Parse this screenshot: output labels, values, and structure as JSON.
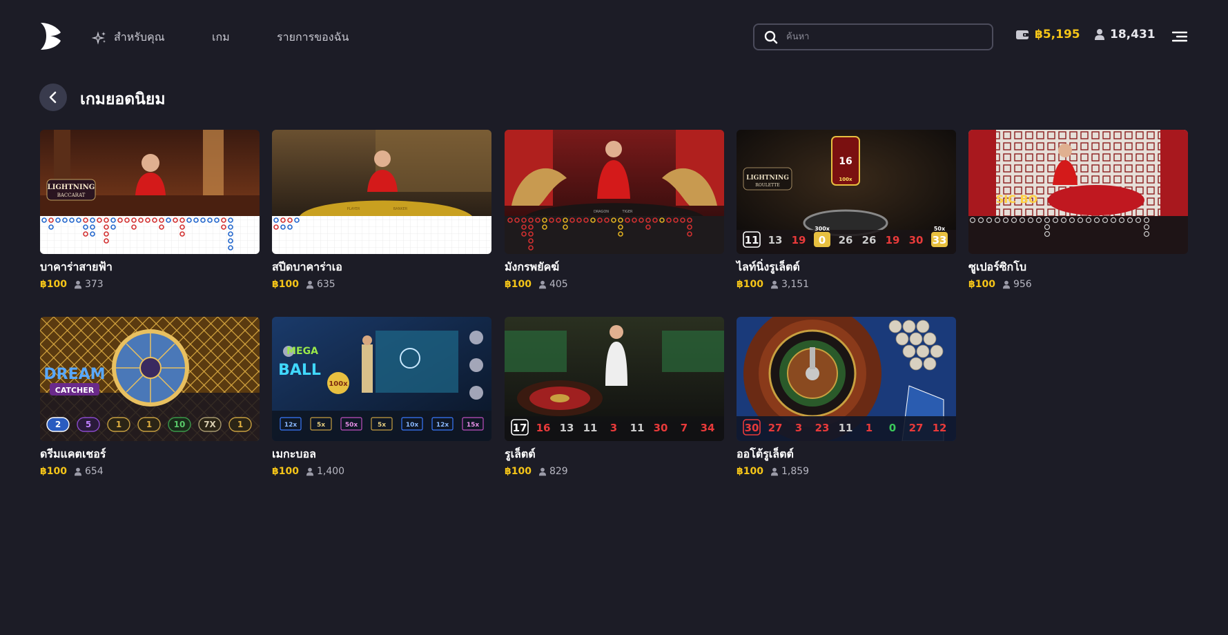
{
  "nav": {
    "for_you": "สำหรับคุณ",
    "games": "เกม",
    "my_list": "รายการของฉัน"
  },
  "search": {
    "placeholder": "ค้นหา"
  },
  "wallet": {
    "balance": "฿5,195"
  },
  "players": {
    "online": "18,431"
  },
  "page": {
    "title": "เกมยอดนิยม"
  },
  "colors": {
    "accent": "#f5c518",
    "background": "#1c1c26"
  },
  "games": [
    {
      "name": "บาคาร่าสายฟ้า",
      "stake": "฿100",
      "players": "373",
      "thumb_text": [
        "LIGHTNING",
        "BACCARAT"
      ]
    },
    {
      "name": "สปีดบาคาร่าเอ",
      "stake": "฿100",
      "players": "635",
      "thumb_text": [
        "PLAYER",
        "BANKER"
      ]
    },
    {
      "name": "มังกรพยัคฆ์",
      "stake": "฿100",
      "players": "405",
      "thumb_text": [
        "DRAGON",
        "TIGER"
      ]
    },
    {
      "name": "ไลท์นิ่งรูเล็ตต์",
      "stake": "฿100",
      "players": "3,151",
      "thumb_text": [
        "LIGHTNING",
        "ROULETTE",
        "16",
        "100x",
        "300x",
        "50x"
      ],
      "results": [
        "11",
        "13",
        "19",
        "0",
        "26",
        "26",
        "19",
        "30",
        "33"
      ]
    },
    {
      "name": "ซูเปอร์ซิกโบ",
      "stake": "฿100",
      "players": "956",
      "thumb_text": [
        "SIC BO"
      ]
    },
    {
      "name": "ดรีมแคตเชอร์",
      "stake": "฿100",
      "players": "654",
      "thumb_text": [
        "DREAM",
        "CATCHER"
      ],
      "results": [
        "2",
        "5",
        "1",
        "1",
        "10",
        "7X",
        "1"
      ]
    },
    {
      "name": "เมกะบอล",
      "stake": "฿100",
      "players": "1,400",
      "thumb_text": [
        "MEGA",
        "BALL",
        "100x"
      ],
      "results": [
        "12x",
        "5x",
        "50x",
        "5x",
        "10x",
        "12x",
        "15x"
      ]
    },
    {
      "name": "รูเล็ตต์",
      "stake": "฿100",
      "players": "829",
      "results": [
        "17",
        "16",
        "13",
        "11",
        "3",
        "11",
        "30",
        "7",
        "34"
      ]
    },
    {
      "name": "ออโต้รูเล็ตต์",
      "stake": "฿100",
      "players": "1,859",
      "results": [
        "30",
        "27",
        "3",
        "23",
        "11",
        "1",
        "0",
        "27",
        "12"
      ]
    }
  ]
}
